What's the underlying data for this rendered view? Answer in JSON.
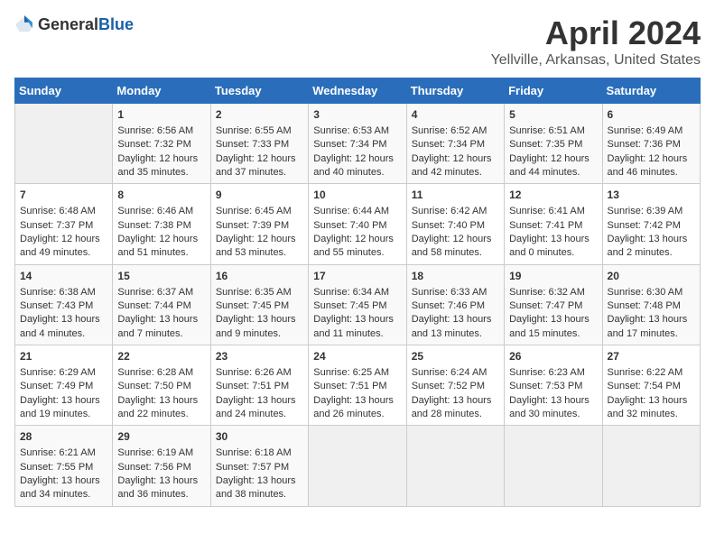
{
  "header": {
    "logo_general": "General",
    "logo_blue": "Blue",
    "title": "April 2024",
    "subtitle": "Yellville, Arkansas, United States"
  },
  "calendar": {
    "days_of_week": [
      "Sunday",
      "Monday",
      "Tuesday",
      "Wednesday",
      "Thursday",
      "Friday",
      "Saturday"
    ],
    "weeks": [
      [
        {
          "day": "",
          "empty": true
        },
        {
          "day": "1",
          "sunrise": "Sunrise: 6:56 AM",
          "sunset": "Sunset: 7:32 PM",
          "daylight": "Daylight: 12 hours and 35 minutes."
        },
        {
          "day": "2",
          "sunrise": "Sunrise: 6:55 AM",
          "sunset": "Sunset: 7:33 PM",
          "daylight": "Daylight: 12 hours and 37 minutes."
        },
        {
          "day": "3",
          "sunrise": "Sunrise: 6:53 AM",
          "sunset": "Sunset: 7:34 PM",
          "daylight": "Daylight: 12 hours and 40 minutes."
        },
        {
          "day": "4",
          "sunrise": "Sunrise: 6:52 AM",
          "sunset": "Sunset: 7:34 PM",
          "daylight": "Daylight: 12 hours and 42 minutes."
        },
        {
          "day": "5",
          "sunrise": "Sunrise: 6:51 AM",
          "sunset": "Sunset: 7:35 PM",
          "daylight": "Daylight: 12 hours and 44 minutes."
        },
        {
          "day": "6",
          "sunrise": "Sunrise: 6:49 AM",
          "sunset": "Sunset: 7:36 PM",
          "daylight": "Daylight: 12 hours and 46 minutes."
        }
      ],
      [
        {
          "day": "7",
          "sunrise": "Sunrise: 6:48 AM",
          "sunset": "Sunset: 7:37 PM",
          "daylight": "Daylight: 12 hours and 49 minutes."
        },
        {
          "day": "8",
          "sunrise": "Sunrise: 6:46 AM",
          "sunset": "Sunset: 7:38 PM",
          "daylight": "Daylight: 12 hours and 51 minutes."
        },
        {
          "day": "9",
          "sunrise": "Sunrise: 6:45 AM",
          "sunset": "Sunset: 7:39 PM",
          "daylight": "Daylight: 12 hours and 53 minutes."
        },
        {
          "day": "10",
          "sunrise": "Sunrise: 6:44 AM",
          "sunset": "Sunset: 7:40 PM",
          "daylight": "Daylight: 12 hours and 55 minutes."
        },
        {
          "day": "11",
          "sunrise": "Sunrise: 6:42 AM",
          "sunset": "Sunset: 7:40 PM",
          "daylight": "Daylight: 12 hours and 58 minutes."
        },
        {
          "day": "12",
          "sunrise": "Sunrise: 6:41 AM",
          "sunset": "Sunset: 7:41 PM",
          "daylight": "Daylight: 13 hours and 0 minutes."
        },
        {
          "day": "13",
          "sunrise": "Sunrise: 6:39 AM",
          "sunset": "Sunset: 7:42 PM",
          "daylight": "Daylight: 13 hours and 2 minutes."
        }
      ],
      [
        {
          "day": "14",
          "sunrise": "Sunrise: 6:38 AM",
          "sunset": "Sunset: 7:43 PM",
          "daylight": "Daylight: 13 hours and 4 minutes."
        },
        {
          "day": "15",
          "sunrise": "Sunrise: 6:37 AM",
          "sunset": "Sunset: 7:44 PM",
          "daylight": "Daylight: 13 hours and 7 minutes."
        },
        {
          "day": "16",
          "sunrise": "Sunrise: 6:35 AM",
          "sunset": "Sunset: 7:45 PM",
          "daylight": "Daylight: 13 hours and 9 minutes."
        },
        {
          "day": "17",
          "sunrise": "Sunrise: 6:34 AM",
          "sunset": "Sunset: 7:45 PM",
          "daylight": "Daylight: 13 hours and 11 minutes."
        },
        {
          "day": "18",
          "sunrise": "Sunrise: 6:33 AM",
          "sunset": "Sunset: 7:46 PM",
          "daylight": "Daylight: 13 hours and 13 minutes."
        },
        {
          "day": "19",
          "sunrise": "Sunrise: 6:32 AM",
          "sunset": "Sunset: 7:47 PM",
          "daylight": "Daylight: 13 hours and 15 minutes."
        },
        {
          "day": "20",
          "sunrise": "Sunrise: 6:30 AM",
          "sunset": "Sunset: 7:48 PM",
          "daylight": "Daylight: 13 hours and 17 minutes."
        }
      ],
      [
        {
          "day": "21",
          "sunrise": "Sunrise: 6:29 AM",
          "sunset": "Sunset: 7:49 PM",
          "daylight": "Daylight: 13 hours and 19 minutes."
        },
        {
          "day": "22",
          "sunrise": "Sunrise: 6:28 AM",
          "sunset": "Sunset: 7:50 PM",
          "daylight": "Daylight: 13 hours and 22 minutes."
        },
        {
          "day": "23",
          "sunrise": "Sunrise: 6:26 AM",
          "sunset": "Sunset: 7:51 PM",
          "daylight": "Daylight: 13 hours and 24 minutes."
        },
        {
          "day": "24",
          "sunrise": "Sunrise: 6:25 AM",
          "sunset": "Sunset: 7:51 PM",
          "daylight": "Daylight: 13 hours and 26 minutes."
        },
        {
          "day": "25",
          "sunrise": "Sunrise: 6:24 AM",
          "sunset": "Sunset: 7:52 PM",
          "daylight": "Daylight: 13 hours and 28 minutes."
        },
        {
          "day": "26",
          "sunrise": "Sunrise: 6:23 AM",
          "sunset": "Sunset: 7:53 PM",
          "daylight": "Daylight: 13 hours and 30 minutes."
        },
        {
          "day": "27",
          "sunrise": "Sunrise: 6:22 AM",
          "sunset": "Sunset: 7:54 PM",
          "daylight": "Daylight: 13 hours and 32 minutes."
        }
      ],
      [
        {
          "day": "28",
          "sunrise": "Sunrise: 6:21 AM",
          "sunset": "Sunset: 7:55 PM",
          "daylight": "Daylight: 13 hours and 34 minutes."
        },
        {
          "day": "29",
          "sunrise": "Sunrise: 6:19 AM",
          "sunset": "Sunset: 7:56 PM",
          "daylight": "Daylight: 13 hours and 36 minutes."
        },
        {
          "day": "30",
          "sunrise": "Sunrise: 6:18 AM",
          "sunset": "Sunset: 7:57 PM",
          "daylight": "Daylight: 13 hours and 38 minutes."
        },
        {
          "day": "",
          "empty": true
        },
        {
          "day": "",
          "empty": true
        },
        {
          "day": "",
          "empty": true
        },
        {
          "day": "",
          "empty": true
        }
      ]
    ]
  }
}
